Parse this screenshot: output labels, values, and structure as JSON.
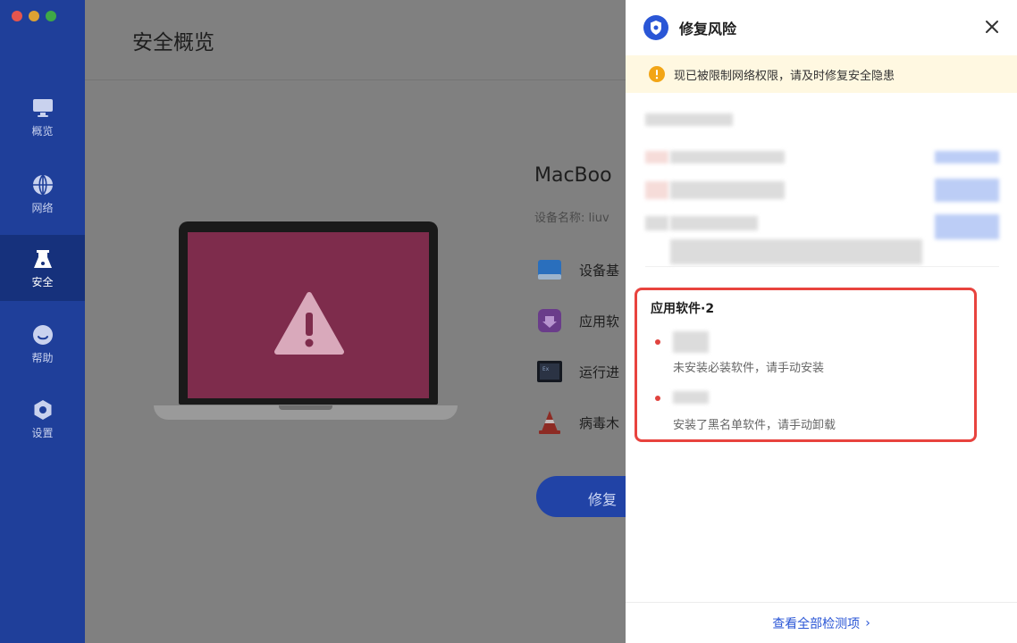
{
  "sidebar": {
    "items": [
      {
        "label": "概览",
        "icon": "monitor-icon"
      },
      {
        "label": "网络",
        "icon": "globe-icon"
      },
      {
        "label": "安全",
        "icon": "flask-icon",
        "active": true
      },
      {
        "label": "帮助",
        "icon": "help-icon"
      },
      {
        "label": "设置",
        "icon": "gear-icon"
      }
    ]
  },
  "main": {
    "title": "安全概览",
    "device_title": "MacBoo",
    "device_name": "设备名称: liuv",
    "checks": [
      {
        "label": "设备基",
        "icon": "disk-icon"
      },
      {
        "label": "应用软",
        "icon": "app-store-icon"
      },
      {
        "label": "运行进",
        "icon": "terminal-icon"
      },
      {
        "label": "病毒木",
        "icon": "traffic-cone-icon"
      }
    ],
    "fix_button": "修复"
  },
  "panel": {
    "title": "修复风险",
    "warning": "现已被限制网络权限，请及时修复安全隐患",
    "software_section": {
      "title": "应用软件·2",
      "items": [
        {
          "desc": "未安装必装软件，请手动安装"
        },
        {
          "desc": "安装了黑名单软件，请手动卸载"
        }
      ]
    },
    "footer_link": "查看全部检测项",
    "footer_arrow": "›"
  },
  "colors": {
    "sidebar": "#1f3f9a",
    "accent": "#2a56d6",
    "warning": "#f2a516",
    "highlight_border": "#e8433e"
  }
}
